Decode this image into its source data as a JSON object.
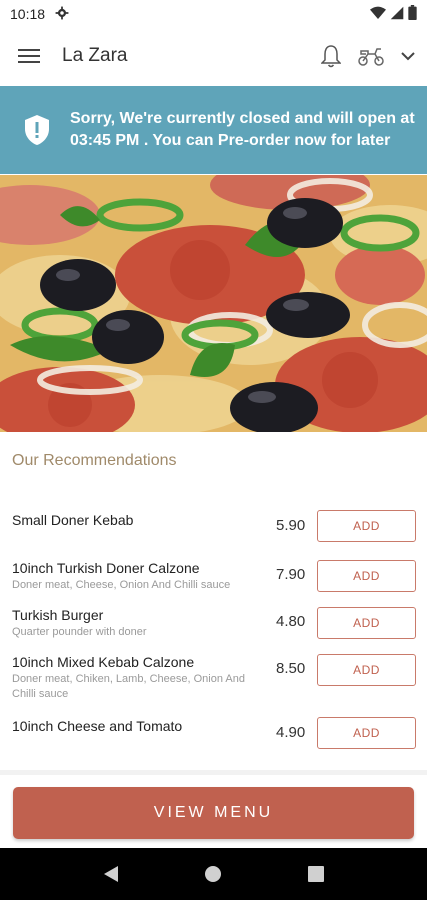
{
  "status_bar": {
    "time": "10:18"
  },
  "app_bar": {
    "title": "La Zara"
  },
  "banner": {
    "message": "Sorry, We're currently closed and will open at 03:45 PM . You can Pre-order now for later",
    "color": "#5fa4b9"
  },
  "recommendations": {
    "title": "Our Recommendations",
    "add_label": "ADD",
    "items": [
      {
        "name": "Small Doner Kebab",
        "description": "",
        "price": "5.90"
      },
      {
        "name": "10inch Turkish Doner Calzone",
        "description": "Doner meat, Cheese, Onion And Chilli sauce",
        "price": "7.90"
      },
      {
        "name": "Turkish Burger",
        "description": "Quarter pounder with doner",
        "price": "4.80"
      },
      {
        "name": "10inch Mixed Kebab Calzone",
        "description": "Doner meat, Chiken, Lamb, Cheese, Onion And Chilli sauce",
        "price": "8.50"
      },
      {
        "name": "10inch Cheese and Tomato",
        "description": "",
        "price": "4.90"
      }
    ]
  },
  "view_menu": {
    "label": "VIEW MENU",
    "color": "#c0614f"
  },
  "icons": [
    "gear-icon",
    "wifi-icon",
    "signal-icon",
    "battery-icon",
    "menu-icon",
    "bell-icon",
    "scooter-icon",
    "chevron-down-icon",
    "shield-alert-icon",
    "back-icon",
    "home-icon",
    "recents-icon"
  ]
}
